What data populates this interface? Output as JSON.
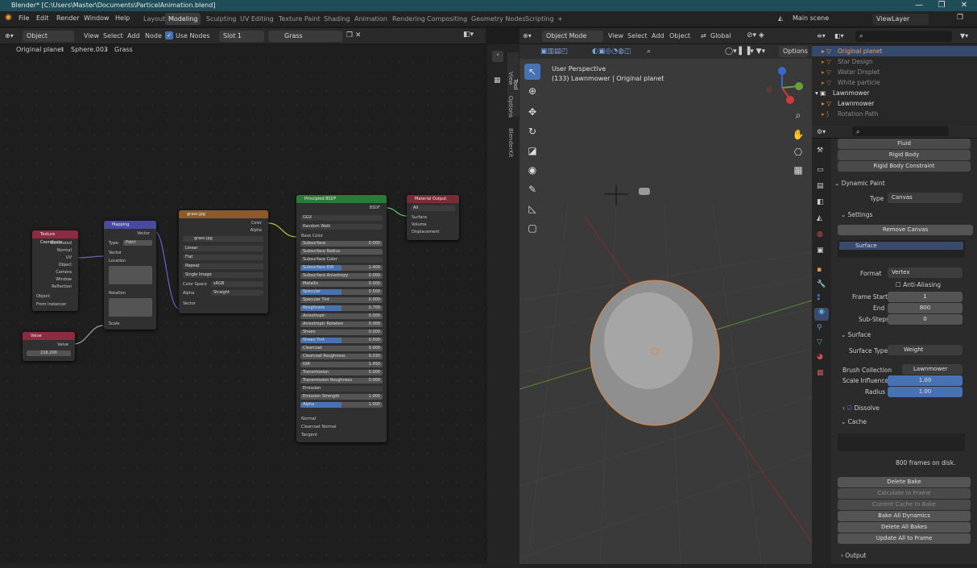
{
  "titlebar": {
    "text": "Blender* [C:\\Users\\Master\\Documents\\ParticelAnimation.blend]",
    "min": "—",
    "max": "❐",
    "close": "✕"
  },
  "menu": {
    "items": [
      "File",
      "Edit",
      "Render",
      "Window",
      "Help"
    ],
    "workspaces": [
      "Layout",
      "Modeling",
      "Sculpting",
      "UV Editing",
      "Texture Paint",
      "Shading",
      "Animation",
      "Rendering",
      "Compositing",
      "Geometry Nodes",
      "Scripting",
      "+"
    ],
    "active_workspace": "Modeling",
    "scene": "Main scene",
    "view_layer": "ViewLayer"
  },
  "node_header": {
    "object": "Object",
    "menus": [
      "View",
      "Select",
      "Add",
      "Node"
    ],
    "use_nodes": "Use Nodes",
    "slot": "Slot 1",
    "material": "Grass"
  },
  "breadcrumb": [
    "Original planet",
    "Sphere.003",
    "Grass"
  ],
  "side_tabs": [
    "Tool",
    "View",
    "Options",
    "BlenderKit"
  ],
  "nodes": {
    "texcoord": {
      "title": "Texture Coordinate",
      "outputs": [
        "Generated",
        "Normal",
        "UV",
        "Object",
        "Camera",
        "Window",
        "Reflection"
      ],
      "object_label": "Object:",
      "from_instancer": "From Instancer"
    },
    "mapping": {
      "title": "Mapping",
      "out": "Vector",
      "type_label": "Type:",
      "type": "Point",
      "vector": "Vector",
      "location": "Location",
      "rotation": "Rotation",
      "scale": "Scale",
      "loc": [
        "X",
        "0 m",
        "Y",
        "0 m",
        "Z",
        "0 m"
      ],
      "rot": [
        "X",
        "0°",
        "Y",
        "0°",
        "Z",
        "0°"
      ]
    },
    "image": {
      "title": "grass.jpg",
      "outs": [
        "Color",
        "Alpha"
      ],
      "file": "grass.jpg",
      "interp": "Linear",
      "proj": "Flat",
      "ext": "Repeat",
      "src": "Single Image",
      "cs_label": "Color Space",
      "cs": "sRGB",
      "alpha_label": "Alpha",
      "alpha": "Straight",
      "vector": "Vector"
    },
    "value": {
      "title": "Value",
      "out": "Value",
      "val": "216.200"
    },
    "bsdf": {
      "title": "Principled BSDF",
      "out": "BSDF",
      "dist": "GGX",
      "sss": "Random Walk",
      "base": "Base Color",
      "rows": [
        [
          "Subsurface",
          "0.000"
        ],
        [
          "Subsurface Radius",
          ""
        ],
        [
          "Subsurface Color",
          ""
        ],
        [
          "Subsurface IOR",
          "1.400"
        ],
        [
          "Subsurface Anisotropy",
          "0.000"
        ],
        [
          "Metallic",
          "0.000"
        ],
        [
          "Specular",
          "0.500"
        ],
        [
          "Specular Tint",
          "0.000"
        ],
        [
          "Roughness",
          "0.700"
        ],
        [
          "Anisotropic",
          "0.000"
        ],
        [
          "Anisotropic Rotation",
          "0.000"
        ],
        [
          "Sheen",
          "0.000"
        ],
        [
          "Sheen Tint",
          "0.500"
        ],
        [
          "Clearcoat",
          "0.000"
        ],
        [
          "Clearcoat Roughness",
          "0.030"
        ],
        [
          "IOR",
          "1.450"
        ],
        [
          "Transmission",
          "0.000"
        ],
        [
          "Transmission Roughness",
          "0.000"
        ],
        [
          "Emission",
          ""
        ],
        [
          "Emission Strength",
          "1.000"
        ],
        [
          "Alpha",
          "1.000"
        ]
      ],
      "tail": [
        "Normal",
        "Clearcoat Normal",
        "Tangent"
      ]
    },
    "output": {
      "title": "Material Output",
      "target": "All",
      "inputs": [
        "Surface",
        "Volume",
        "Displacement"
      ]
    }
  },
  "viewport": {
    "mode": "Object Mode",
    "menus": [
      "View",
      "Select",
      "Add",
      "Object"
    ],
    "orient": "Global",
    "options": "Options",
    "persp": "User Perspective",
    "info": "(133) Lawnmower | Original planet"
  },
  "outliner": {
    "rows": [
      [
        "Original planet",
        true
      ],
      [
        "Star Design",
        false
      ],
      [
        "Water Droplet",
        false
      ],
      [
        "White particle",
        false
      ],
      [
        "Lawnmower",
        false
      ],
      [
        "Lawnmower",
        false
      ],
      [
        "Rotation Path",
        false
      ]
    ]
  },
  "props": {
    "physics": [
      "Fluid",
      "Rigid Body",
      "Rigid Body Constraint"
    ],
    "dynamic_paint": "Dynamic Paint",
    "type_label": "Type",
    "type": "Canvas",
    "settings": "Settings",
    "remove": "Remove Canvas",
    "surface_item": "Surface",
    "format_label": "Format",
    "format": "Vertex",
    "aa": "Anti-Aliasing",
    "frame_start_label": "Frame Start",
    "frame_start": "1",
    "end_label": "End",
    "end": "800",
    "substeps_label": "Sub-Steps",
    "substeps": "0",
    "surface": "Surface",
    "stype_label": "Surface Type",
    "stype": "Weight",
    "brush_label": "Brush Collection",
    "brush": "Lawnmower",
    "si_label": "Scale Influence",
    "si": "1.00",
    "radius_label": "Radius",
    "radius": "1.00",
    "dissolve": "Dissolve",
    "cache": "Cache",
    "frames_on_disk": "800 frames on disk.",
    "bake": [
      "Delete Bake",
      "Calculate to Frame",
      "Current Cache to Bake",
      "Bake All Dynamics",
      "Delete All Bakes",
      "Update All to Frame"
    ],
    "output": "Output"
  },
  "colors": {
    "accent": "#4772b3",
    "active_ws": "#3c3c3c",
    "grid_x": "#8a2a2a",
    "grid_y": "#5a8a2a"
  }
}
